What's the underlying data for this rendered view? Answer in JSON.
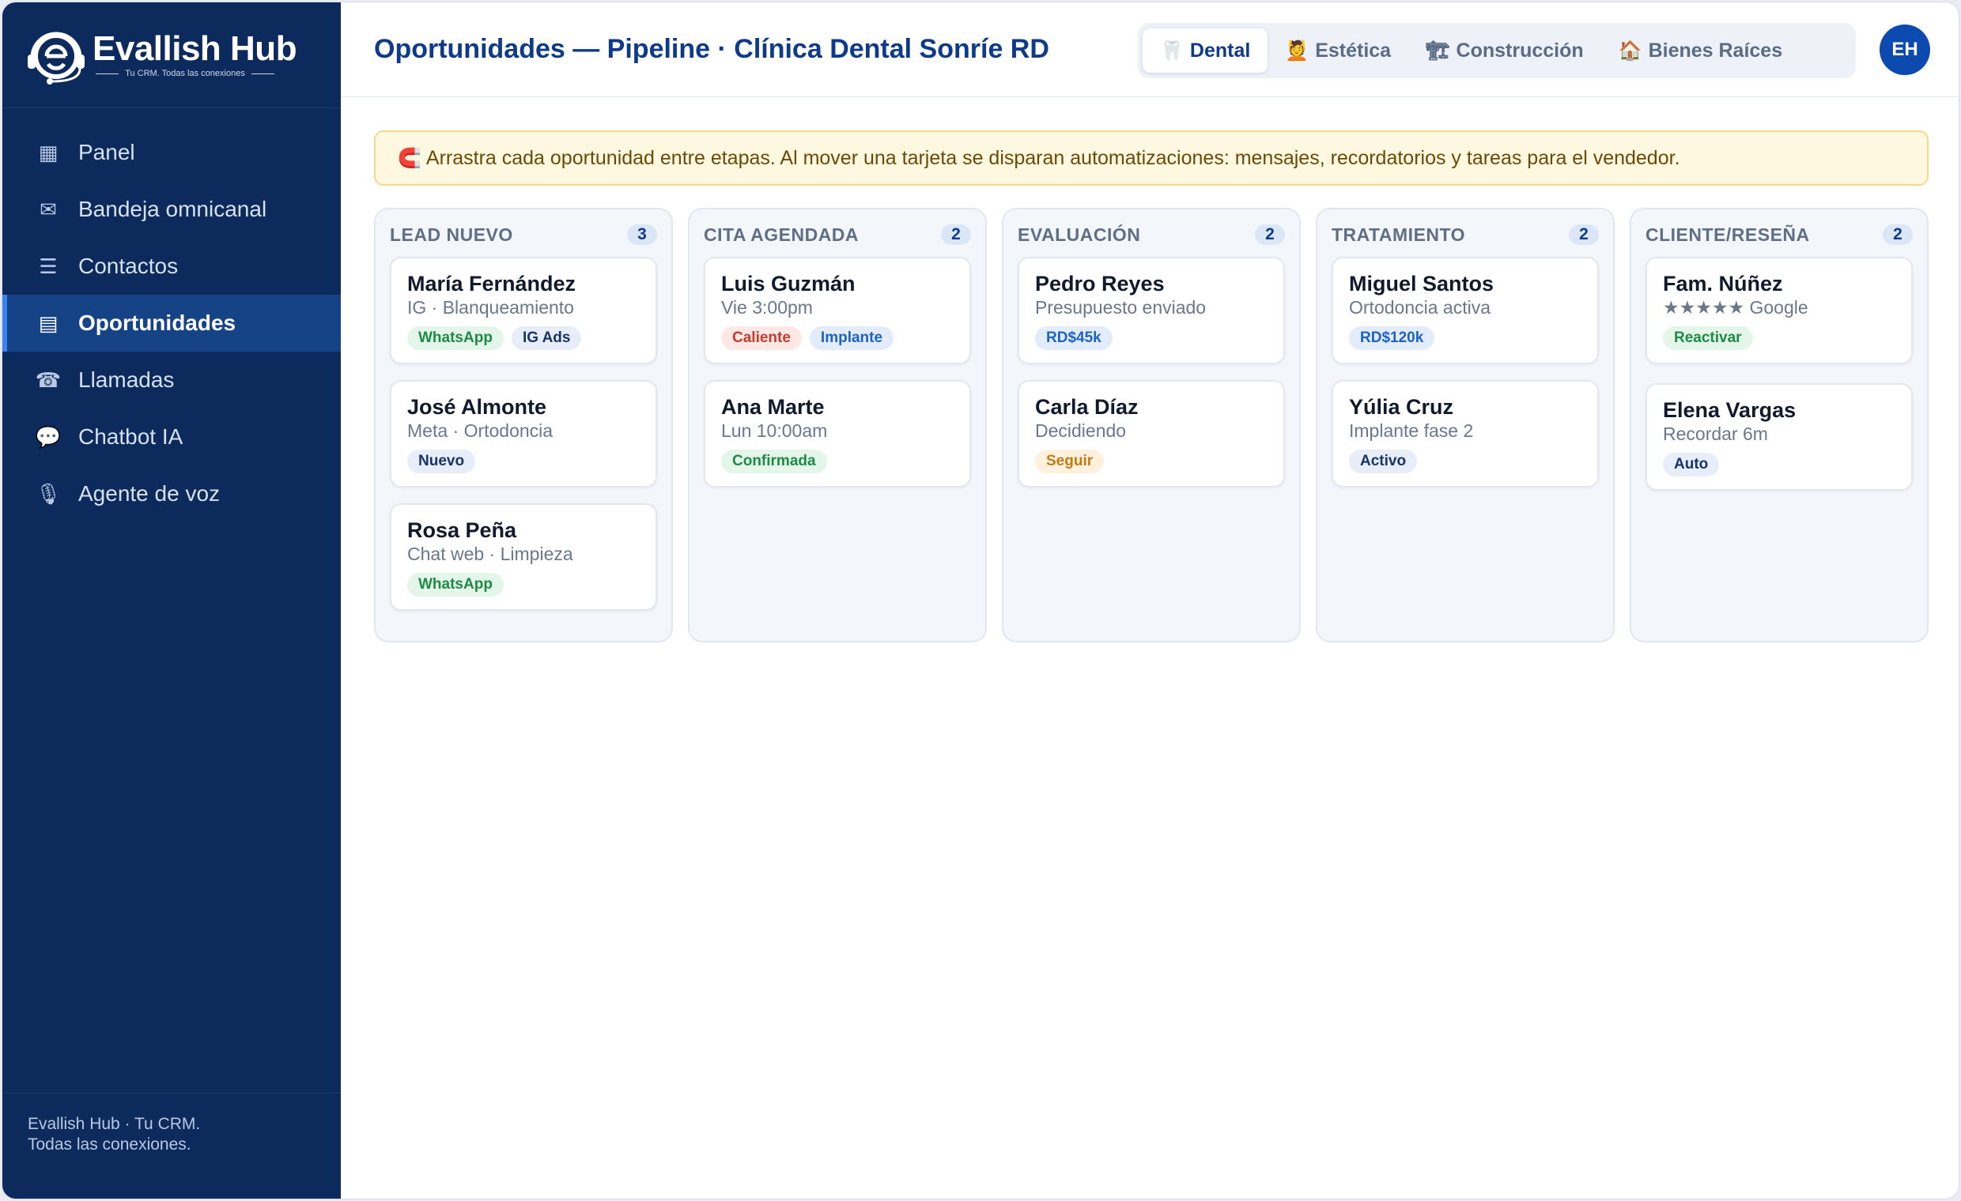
{
  "brand": {
    "name": "Evallish Hub",
    "tagline": "Tu CRM. Todas las conexiones"
  },
  "sidebar": {
    "items": [
      {
        "label": "Panel",
        "icon": "grid-icon",
        "glyph": "▦"
      },
      {
        "label": "Bandeja omnicanal",
        "icon": "envelope-icon",
        "glyph": "✉"
      },
      {
        "label": "Contactos",
        "icon": "list-icon",
        "glyph": "☰"
      },
      {
        "label": "Oportunidades",
        "icon": "board-icon",
        "glyph": "▤"
      },
      {
        "label": "Llamadas",
        "icon": "phone-icon",
        "glyph": "☎"
      },
      {
        "label": "Chatbot IA",
        "icon": "chat-bubble-icon",
        "glyph": "💬"
      },
      {
        "label": "Agente de voz",
        "icon": "microphone-icon",
        "glyph": "🎙"
      }
    ],
    "footer_line1": "Evallish Hub · Tu CRM.",
    "footer_line2": "Todas las conexiones."
  },
  "header": {
    "title": "Oportunidades — Pipeline · Clínica Dental Sonríe RD",
    "tabs": [
      {
        "label": "Dental",
        "icon": "tooth-icon",
        "glyph": "🦷"
      },
      {
        "label": "Estética",
        "icon": "beauty-icon",
        "glyph": "💆"
      },
      {
        "label": "Construcción",
        "icon": "crane-icon",
        "glyph": "🏗"
      },
      {
        "label": "Bienes Raíces",
        "icon": "house-icon",
        "glyph": "🏠"
      }
    ],
    "avatar_initials": "EH"
  },
  "banner": {
    "icon_glyph": "🧲",
    "text": "Arrastra cada oportunidad entre etapas. Al mover una tarjeta se disparan automatizaciones: mensajes, recordatorios y tareas para el vendedor."
  },
  "pipeline": {
    "columns": [
      {
        "title": "LEAD NUEVO",
        "count": "3",
        "cards": [
          {
            "name": "María Fernández",
            "sub": "IG · Blanqueamiento",
            "tags": [
              "WhatsApp",
              "IG Ads"
            ]
          },
          {
            "name": "José Almonte",
            "sub": "Meta · Ortodoncia",
            "tags": [
              "Nuevo"
            ]
          },
          {
            "name": "Rosa Peña",
            "sub": "Chat web · Limpieza",
            "tags": [
              "WhatsApp"
            ]
          }
        ]
      },
      {
        "title": "CITA AGENDADA",
        "count": "2",
        "cards": [
          {
            "name": "Luis Guzmán",
            "sub": "Vie 3:00pm",
            "tags": [
              "Caliente",
              "Implante"
            ]
          },
          {
            "name": "Ana Marte",
            "sub": "Lun 10:00am",
            "tags": [
              "Confirmada"
            ]
          }
        ]
      },
      {
        "title": "EVALUACIÓN",
        "count": "2",
        "cards": [
          {
            "name": "Pedro Reyes",
            "sub": "Presupuesto enviado",
            "tags": [
              "RD$45k"
            ]
          },
          {
            "name": "Carla Díaz",
            "sub": "Decidiendo",
            "tags": [
              "Seguir"
            ]
          }
        ]
      },
      {
        "title": "TRATAMIENTO",
        "count": "2",
        "cards": [
          {
            "name": "Miguel Santos",
            "sub": "Ortodoncia activa",
            "tags": [
              "RD$120k"
            ]
          },
          {
            "name": "Yúlia Cruz",
            "sub": "Implante fase 2",
            "tags": [
              "Activo"
            ]
          }
        ]
      },
      {
        "title": "CLIENTE/RESEÑA",
        "count": "2",
        "cards": [
          {
            "name": "Fam. Núñez",
            "sub": "★★★★★ Google",
            "tags": [
              "Reactivar"
            ]
          },
          {
            "name": "Elena Vargas",
            "sub": "Recordar 6m",
            "tags": [
              "Auto"
            ]
          }
        ]
      }
    ]
  },
  "colors": {
    "sidebar_bg": "#0c2a5b",
    "accent": "#0d3b8a",
    "tag_green": "#1f8a45",
    "tag_red": "#c83a2c",
    "tag_orange": "#c77a12",
    "tag_blue": "#1d63c7"
  }
}
